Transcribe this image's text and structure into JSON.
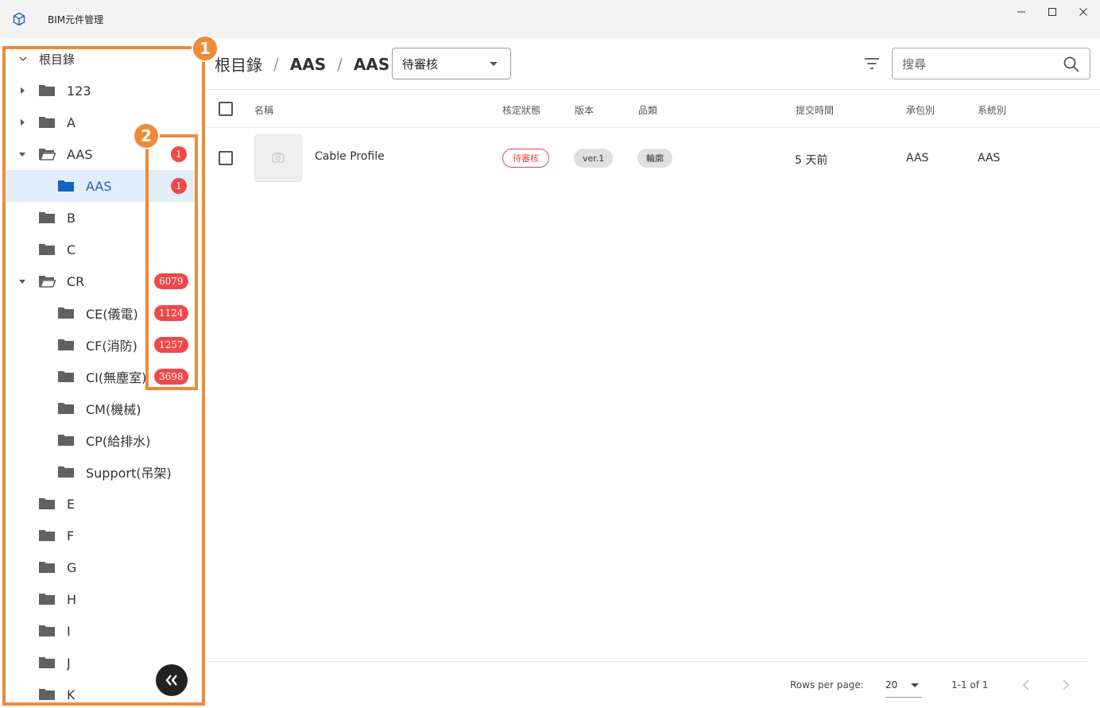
{
  "app": {
    "title": "BIM元件管理",
    "icon": "cube-icon"
  },
  "window_controls": [
    "minimize-icon",
    "maximize-icon",
    "close-icon"
  ],
  "sidebar": {
    "root_label": "根目錄",
    "items": [
      {
        "label": "123",
        "expanded": false,
        "has_children": true
      },
      {
        "label": "A",
        "expanded": false,
        "has_children": true
      },
      {
        "label": "AAS",
        "expanded": true,
        "has_children": true,
        "count": "1"
      },
      {
        "label": "AAS",
        "selected": true,
        "count": "1"
      },
      {
        "label": "B"
      },
      {
        "label": "C"
      },
      {
        "label": "CR",
        "expanded": true,
        "has_children": true,
        "count": "6079"
      },
      {
        "label": "CE(儀電)",
        "count": "1124"
      },
      {
        "label": "CF(消防)",
        "count": "1257"
      },
      {
        "label": "CI(無塵室)",
        "count": "3698"
      },
      {
        "label": "CM(機械)"
      },
      {
        "label": "CP(給排水)"
      },
      {
        "label": "Support(吊架)"
      },
      {
        "label": "E"
      },
      {
        "label": "F"
      },
      {
        "label": "G"
      },
      {
        "label": "H"
      },
      {
        "label": "I"
      },
      {
        "label": "J"
      },
      {
        "label": "K"
      }
    ],
    "collapse_icon": "double-chevron-left-icon"
  },
  "annotations": {
    "box1_number": "1",
    "box2_number": "2",
    "color": "#ef8a37"
  },
  "breadcrumb": [
    "根目錄",
    "AAS",
    "AAS"
  ],
  "breadcrumb_separator": "/",
  "status_filter": {
    "value": "待審核"
  },
  "search": {
    "placeholder": "搜尋"
  },
  "table": {
    "columns": [
      "名稱",
      "核定狀態",
      "版本",
      "品類",
      "提交時間",
      "承包別",
      "系統別"
    ],
    "rows": [
      {
        "name": "Cable Profile",
        "status": "待審核",
        "version": "ver.1",
        "category": "輪廓",
        "submitted": "5 天前",
        "contractor": "AAS",
        "system": "AAS"
      }
    ]
  },
  "pagination": {
    "rows_per_page_label": "Rows per page:",
    "rows_per_page": "20",
    "range": "1-1 of 1"
  },
  "colors": {
    "badge": "#f04848",
    "selected_bg": "#e3eefb",
    "selected_text": "#1565c0",
    "folder": "#616161",
    "folder_selected": "#1565c0"
  }
}
